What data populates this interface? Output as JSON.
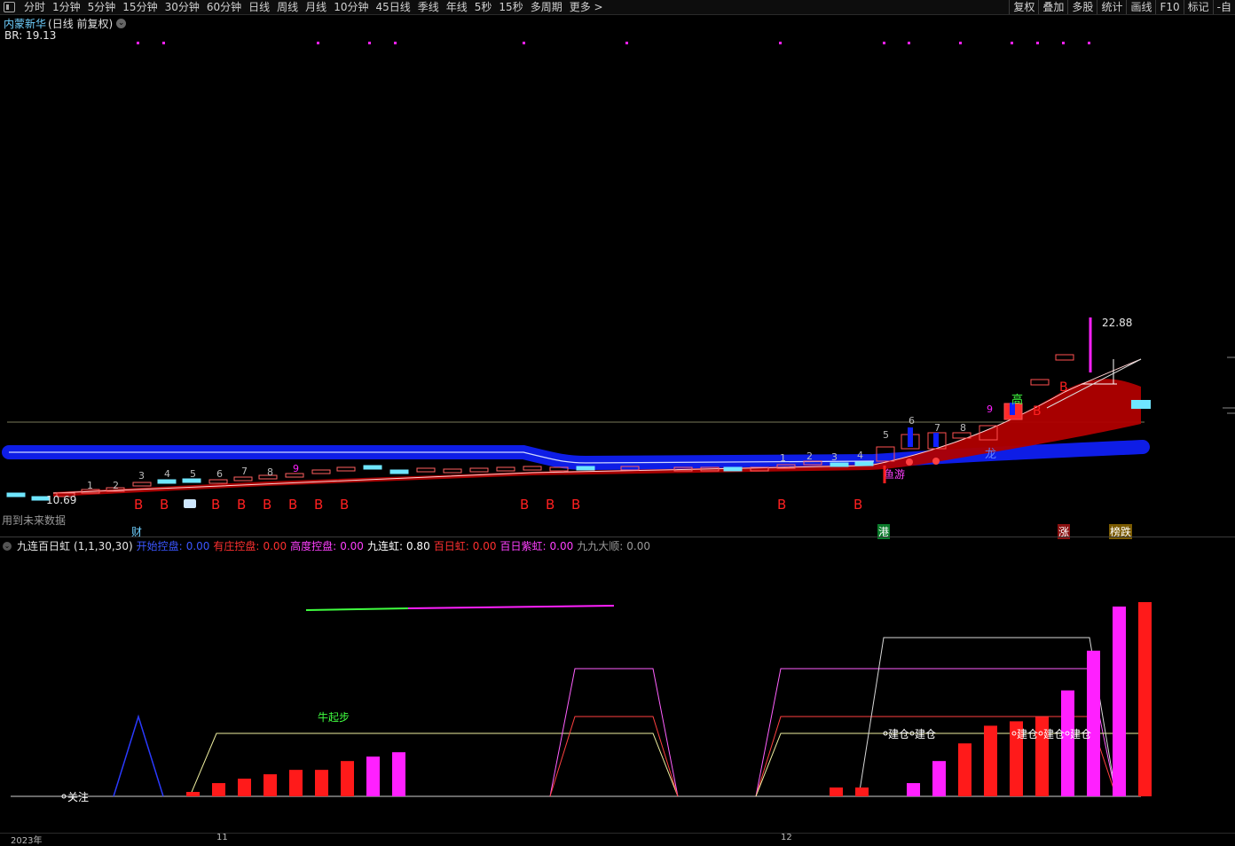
{
  "toolbar": {
    "periods": [
      "分时",
      "1分钟",
      "5分钟",
      "15分钟",
      "30分钟",
      "60分钟",
      "日线",
      "周线",
      "月线",
      "10分钟",
      "45日线",
      "季线",
      "年线",
      "5秒",
      "15秒",
      "多周期",
      "更多 >"
    ],
    "actions": [
      "复权",
      "叠加",
      "多股",
      "统计",
      "画线",
      "F10",
      "标记",
      "-自"
    ]
  },
  "stock": {
    "name": "内蒙新华",
    "mode": "(日线 前复权)"
  },
  "br_label": "BR: 19.13",
  "future_data_note": "用到未来数据",
  "price_low_label": "10.69",
  "price_high_label": "22.88",
  "bottom_markers": {
    "cai": "财",
    "gang": "港",
    "zhang": "涨",
    "bangdie": "榜跌"
  },
  "chart_annotations": {
    "b_letter": "B",
    "gao": "高",
    "long": "龙",
    "youyou": "鱼游",
    "niuqibu": "牛起步",
    "guanzhu": "关注",
    "jiancang": "建仓"
  },
  "candle_counts": {
    "first_run": [
      "1",
      "2",
      "3",
      "4",
      "5",
      "6",
      "7",
      "8",
      "9"
    ],
    "second_run": [
      "1",
      "2",
      "3",
      "4",
      "5",
      "6",
      "7",
      "8",
      "9"
    ]
  },
  "indicator": {
    "name": "九连百日虹",
    "params": "(1,1,30,30)",
    "fields": [
      {
        "label": "开始控盘:",
        "value": "0.00",
        "color": "#3b56ff"
      },
      {
        "label": "有庄控盘:",
        "value": "0.00",
        "color": "#ff3030"
      },
      {
        "label": "高度控盘:",
        "value": "0.00",
        "color": "#ff40ff"
      },
      {
        "label": "九连虹:",
        "value": "0.80",
        "color": "#ffffff"
      },
      {
        "label": "百日虹:",
        "value": "0.00",
        "color": "#ff3030"
      },
      {
        "label": "百日紫虹:",
        "value": "0.00",
        "color": "#ff40ff"
      },
      {
        "label": "九九大顺:",
        "value": "0.00",
        "color": "#9a9a9a"
      }
    ]
  },
  "date_axis": [
    "2023年",
    "11",
    "12"
  ],
  "colors": {
    "background": "#000000",
    "candle_up": "#ff3030",
    "candle_down": "#6fe6ff",
    "ribbon_red": "#b00000",
    "ribbon_blue": "#1020ff",
    "magenta": "#ff20ff",
    "bar_red": "#ff1a1a"
  },
  "chart_data": {
    "type": "bar",
    "title": "",
    "series": [
      {
        "values": [
          0,
          0,
          0,
          0,
          0,
          0,
          1,
          3,
          4,
          5,
          6,
          6,
          8,
          9,
          10,
          0,
          0,
          0,
          0,
          0,
          0,
          0,
          0,
          0,
          0,
          0,
          0,
          0,
          0,
          0,
          0,
          2,
          2,
          0,
          3,
          8,
          12,
          16,
          17,
          18,
          24,
          33,
          43,
          44
        ]
      }
    ]
  }
}
